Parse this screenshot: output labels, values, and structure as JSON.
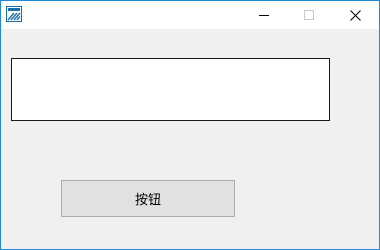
{
  "window": {
    "title": "",
    "controls": {
      "minimize": "minimize-icon",
      "maximize": "maximize-icon",
      "close": "close-icon"
    },
    "border_color": "#1f8ad8",
    "icon_color": "#1a6fa8"
  },
  "form": {
    "text_input_value": "",
    "button_label": "按钮"
  }
}
